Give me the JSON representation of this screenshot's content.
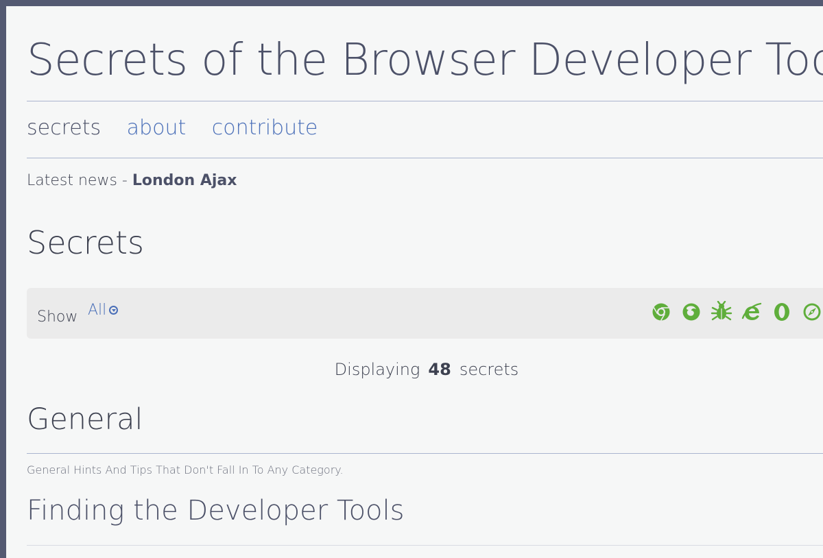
{
  "site": {
    "title": "Secrets of the Browser Developer Tools"
  },
  "nav": {
    "items": [
      {
        "label": "secrets",
        "current": true
      },
      {
        "label": "about",
        "current": false
      },
      {
        "label": "contribute",
        "current": false
      }
    ]
  },
  "news": {
    "prefix": "Latest news - ",
    "link_label": "London Ajax"
  },
  "section": {
    "title": "Secrets"
  },
  "filter": {
    "label": "Show",
    "selected": "All",
    "browsers": [
      {
        "name": "chrome",
        "icon": "chrome-icon"
      },
      {
        "name": "firefox",
        "icon": "firefox-icon"
      },
      {
        "name": "firebug",
        "icon": "bug-icon"
      },
      {
        "name": "internet-explorer",
        "icon": "ie-icon"
      },
      {
        "name": "opera",
        "icon": "opera-icon"
      },
      {
        "name": "safari",
        "icon": "safari-icon"
      }
    ],
    "icon_color": "#5fae3b"
  },
  "results": {
    "prefix": "Displaying",
    "count": "48",
    "suffix": "secrets"
  },
  "category": {
    "title": "General",
    "description": "General Hints And Tips That Don't Fall In To Any Category."
  },
  "secret": {
    "title": "Finding the Developer Tools"
  },
  "colors": {
    "frame": "#545a72",
    "page_bg": "#f6f7f7",
    "link": "#4a6fb8",
    "heading": "#4c5168",
    "rule": "#aab4cf",
    "browser_icon": "#5fae3b"
  }
}
